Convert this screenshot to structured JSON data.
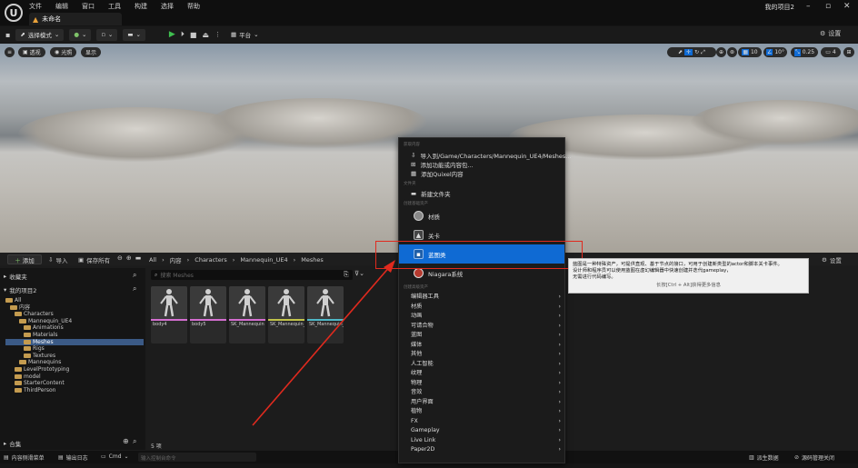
{
  "app": {
    "logo": "U",
    "menu": [
      "文件",
      "编辑",
      "窗口",
      "工具",
      "构建",
      "选择",
      "帮助"
    ],
    "tab_title": "未命名",
    "project_name": "我的项目2"
  },
  "toolbar": {
    "mode": "选择模式",
    "platform": "平台",
    "settings": "设置"
  },
  "viewport": {
    "perspective": "透视",
    "lit": "光照",
    "show": "显示",
    "grid_snap": "10",
    "rot_snap": "10°",
    "scale_snap": "0.25",
    "cam_speed": "4"
  },
  "content_browser": {
    "add": "添加",
    "import": "导入",
    "save_all": "保存所有",
    "breadcrumbs": [
      "All",
      "内容",
      "Characters",
      "Mannequin_UE4",
      "Meshes"
    ],
    "favorites": "收藏夹",
    "project_section": "我的项目2",
    "tree": [
      {
        "label": "All",
        "indent": 0
      },
      {
        "label": "内容",
        "indent": 1
      },
      {
        "label": "Characters",
        "indent": 2
      },
      {
        "label": "Mannequin_UE4",
        "indent": 3
      },
      {
        "label": "Animations",
        "indent": 4
      },
      {
        "label": "Materials",
        "indent": 4
      },
      {
        "label": "Meshes",
        "indent": 4,
        "selected": true
      },
      {
        "label": "Rigs",
        "indent": 4
      },
      {
        "label": "Textures",
        "indent": 4
      },
      {
        "label": "Mannequins",
        "indent": 3
      },
      {
        "label": "LevelPrototyping",
        "indent": 2
      },
      {
        "label": "model",
        "indent": 2
      },
      {
        "label": "StarterContent",
        "indent": 2
      },
      {
        "label": "ThirdPerson",
        "indent": 2
      }
    ],
    "collections": "合集",
    "search_placeholder": "搜索 Meshes",
    "assets": [
      {
        "name": "body4"
      },
      {
        "name": "body5"
      },
      {
        "name": "SK_Mannequin"
      },
      {
        "name": "SK_Mannequin_PhysicsAsset"
      },
      {
        "name": "SK_Mannequin_Skeleton"
      }
    ],
    "item_count": "5 项",
    "settings": "设置"
  },
  "status_bar": {
    "drawer": "内容侧滑菜单",
    "output_log": "输出日志",
    "cmd": "Cmd",
    "cmd_placeholder": "输入控制台命令",
    "derived_data": "派生数据",
    "source_control": "源码管理关闭"
  },
  "context_menu": {
    "section_get": "获取内容",
    "import_to": "导入到/Game/Characters/Mannequin_UE4/Meshes...",
    "add_feature": "添加功能或内容包...",
    "add_quixel": "添加Quixel内容",
    "section_folder": "文件夹",
    "new_folder": "新建文件夹",
    "section_basic": "创建基础资产",
    "material": "材质",
    "level": "关卡",
    "blueprint_class": "蓝图类",
    "niagara": "Niagara系统",
    "section_advanced": "创建高级资产",
    "submenus": [
      "编辑器工具",
      "材质",
      "动画",
      "可请合物",
      "蓝图",
      "媒体",
      "其他",
      "人工智能",
      "纹理",
      "物理",
      "音效",
      "用户界面",
      "植物",
      "FX",
      "Gameplay",
      "Live Link",
      "Paper2D"
    ]
  },
  "tooltip": {
    "line1": "蓝图是一种特殊资产，可提供直观、基于节点的接口，可用于创建新类型的actor和脚本关卡事件。",
    "line2": "设计师和程序员可以使用蓝图在虚幻编辑器中快速创建并迭代gameplay，",
    "line3": "无需进行代码编写。",
    "hint": "长按[Ctrl + Alt]获得更多信息"
  }
}
